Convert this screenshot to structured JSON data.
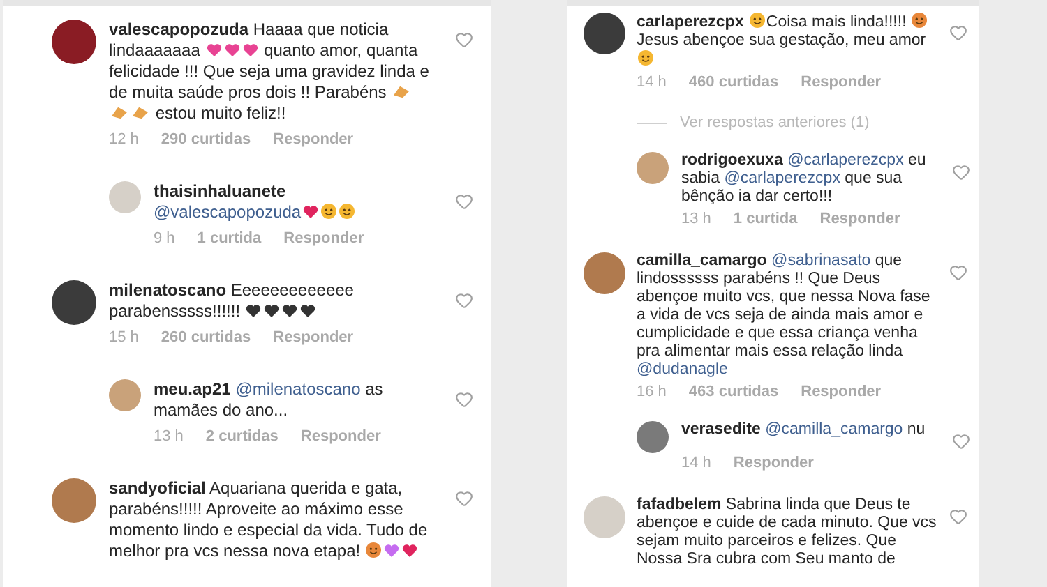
{
  "columns": [
    {
      "comments": [
        {
          "username": "valescapopozuda",
          "body": [
            {
              "kind": "text",
              "text": "Haaaa que noticia lindaaaaaaa "
            },
            {
              "kind": "heart",
              "color": "#e84393"
            },
            {
              "kind": "heart",
              "color": "#e84393"
            },
            {
              "kind": "heart",
              "color": "#e84393"
            },
            {
              "kind": "text",
              "text": " quanto amor, quanta felicidade !!! Que seja uma gravidez linda e de muita saúde pros dois !! Parabéns "
            },
            {
              "kind": "hands",
              "color": "#e8a34a"
            },
            {
              "kind": "hands",
              "color": "#e8a34a"
            },
            {
              "kind": "hands",
              "color": "#e8a34a"
            },
            {
              "kind": "text",
              "text": " estou muito feliz!!"
            }
          ],
          "time": "12 h",
          "likes": "290 curtidas",
          "reply_label": "Responder",
          "replies": [
            {
              "username": "thaisinhaluanete",
              "body": [
                {
                  "kind": "mention",
                  "text": "@valescapopozuda"
                },
                {
                  "kind": "heart",
                  "color": "#e0245e"
                },
                {
                  "kind": "face",
                  "color": "#f5b731"
                },
                {
                  "kind": "face",
                  "color": "#f5b731"
                }
              ],
              "time": "9 h",
              "likes": "1 curtida",
              "reply_label": "Responder"
            }
          ]
        },
        {
          "username": "milenatoscano",
          "body": [
            {
              "kind": "text",
              "text": "Eeeeeeeeeeeee parabensssss!!!!!! "
            },
            {
              "kind": "heart",
              "color": "#333333"
            },
            {
              "kind": "heart",
              "color": "#333333"
            },
            {
              "kind": "heart",
              "color": "#333333"
            },
            {
              "kind": "heart",
              "color": "#333333"
            }
          ],
          "time": "15 h",
          "likes": "260 curtidas",
          "reply_label": "Responder",
          "replies": [
            {
              "username": "meu.ap21",
              "body": [
                {
                  "kind": "mention",
                  "text": "@milenatoscano"
                },
                {
                  "kind": "text",
                  "text": " as mamães do ano..."
                }
              ],
              "time": "13 h",
              "likes": "2 curtidas",
              "reply_label": "Responder"
            }
          ]
        },
        {
          "username": "sandyoficial",
          "body": [
            {
              "kind": "text",
              "text": "Aquariana querida e gata, parabéns!!!!! Aproveite ao máximo esse momento lindo e especial da vida. Tudo de melhor pra vcs nessa nova etapa! "
            },
            {
              "kind": "face",
              "color": "#e8873a"
            },
            {
              "kind": "heart",
              "color": "#c56cf0"
            },
            {
              "kind": "heart",
              "color": "#e0245e"
            }
          ]
        }
      ]
    },
    {
      "comments": [
        {
          "username": "carlaperezcpx",
          "body": [
            {
              "kind": "face",
              "color": "#f5b731"
            },
            {
              "kind": "text",
              "text": "Coisa mais linda!!!!! "
            },
            {
              "kind": "face",
              "color": "#e8873a"
            },
            {
              "kind": "text",
              "text": " Jesus abençoe sua gestação, meu amor "
            },
            {
              "kind": "face",
              "color": "#f5b731"
            }
          ],
          "time": "14 h",
          "likes": "460 curtidas",
          "reply_label": "Responder",
          "view_previous": "Ver respostas anteriores (1)",
          "replies": [
            {
              "username": "rodrigoexuxa",
              "body": [
                {
                  "kind": "mention",
                  "text": "@carlaperezcpx"
                },
                {
                  "kind": "text",
                  "text": " eu sabia "
                },
                {
                  "kind": "mention",
                  "text": "@carlaperezcpx"
                },
                {
                  "kind": "text",
                  "text": " que sua bênção ia dar certo!!!"
                }
              ],
              "time": "13 h",
              "likes": "1 curtida",
              "reply_label": "Responder"
            }
          ]
        },
        {
          "username": "camilla_camargo",
          "body": [
            {
              "kind": "mention",
              "text": "@sabrinasato"
            },
            {
              "kind": "text",
              "text": " que lindossssss parabéns !! Que Deus abençoe muito vcs, que nessa Nova fase a vida de vcs seja de ainda mais amor e cumplicidade e que essa criança venha pra alimentar mais essa relação linda "
            },
            {
              "kind": "mention",
              "text": "@dudanagle"
            }
          ],
          "time": "16 h",
          "likes": "463 curtidas",
          "reply_label": "Responder",
          "replies": [
            {
              "username": "verasedite",
              "body": [
                {
                  "kind": "mention",
                  "text": "@camilla_camargo"
                },
                {
                  "kind": "text",
                  "text": " nu"
                }
              ],
              "time": "14 h",
              "reply_label": "Responder"
            }
          ]
        },
        {
          "username": "fafadbelem",
          "body": [
            {
              "kind": "text",
              "text": "Sabrina linda que Deus te abençoe e cuide de cada minuto.  Que vcs sejam muito parceiros e felizes. Que Nossa Sra cubra com Seu manto de"
            }
          ]
        }
      ]
    }
  ]
}
